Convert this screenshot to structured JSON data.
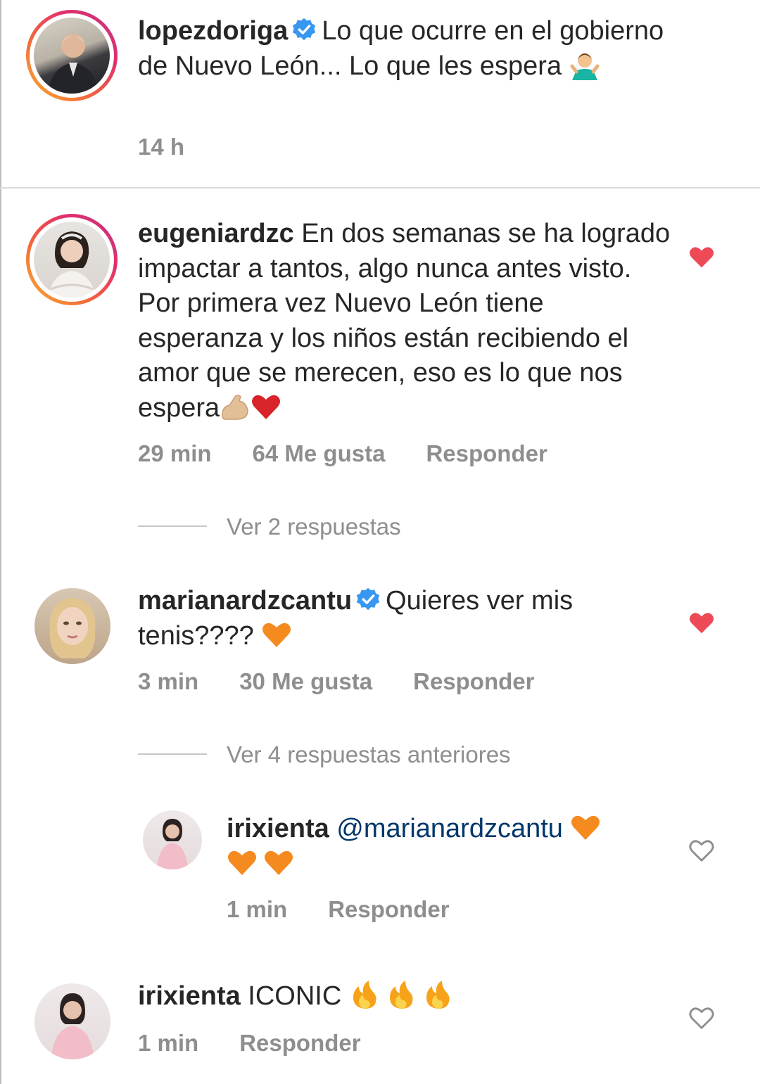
{
  "caption": {
    "username": "lopezdoriga",
    "text": "Lo que ocurre en el gobierno de Nuevo León... Lo que les espera",
    "time": "14 h",
    "emoji": "person-shrugging-emoji"
  },
  "comments": [
    {
      "username": "eugeniardzc",
      "text": "En dos semanas se ha logrado impactar a tantos, algo nunca antes visto. Por primera vez Nuevo León tiene esperanza y los niños están recibiendo el amor que se merecen, eso es lo que nos espera",
      "time": "29 min",
      "likes": "64 Me gusta",
      "reply": "Responder",
      "view_replies": "Ver 2 respuestas",
      "liked": true
    },
    {
      "username": "marianardzcantu",
      "text": "Quieres ver mis tenis????",
      "time": "3 min",
      "likes": "30 Me gusta",
      "reply": "Responder",
      "view_replies": "Ver 4 respuestas anteriores",
      "liked": true
    },
    {
      "username": "irixienta",
      "mention": "@marianardzcantu",
      "time": "1 min",
      "reply": "Responder",
      "liked": false
    },
    {
      "username": "irixienta",
      "text": "ICONIC",
      "time": "1 min",
      "reply": "Responder",
      "liked": false
    }
  ],
  "colors": {
    "heart_red": "#ed4956",
    "verified_blue": "#3897f0",
    "meta_gray": "#8e8e8e",
    "mention_blue": "#00376b"
  },
  "icons": [
    "verified-badge-icon",
    "heart-filled-icon",
    "heart-outline-icon",
    "orange-heart-emoji",
    "red-heart-emoji",
    "flexed-biceps-emoji",
    "fire-emoji"
  ]
}
